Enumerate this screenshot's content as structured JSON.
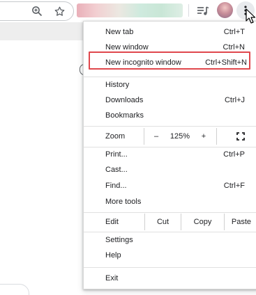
{
  "menu": {
    "items_top": [
      {
        "label": "New tab",
        "accel": "Ctrl+T"
      },
      {
        "label": "New window",
        "accel": "Ctrl+N"
      },
      {
        "label": "New incognito window",
        "accel": "Ctrl+Shift+N"
      }
    ],
    "items_nav": [
      {
        "label": "History",
        "accel": ""
      },
      {
        "label": "Downloads",
        "accel": "Ctrl+J"
      },
      {
        "label": "Bookmarks",
        "accel": ""
      }
    ],
    "zoom": {
      "label": "Zoom",
      "minus": "–",
      "value": "125%",
      "plus": "+"
    },
    "items_tools": [
      {
        "label": "Print...",
        "accel": "Ctrl+P"
      },
      {
        "label": "Cast...",
        "accel": ""
      },
      {
        "label": "Find...",
        "accel": "Ctrl+F"
      },
      {
        "label": "More tools",
        "accel": ""
      }
    ],
    "edit": {
      "label": "Edit",
      "cut": "Cut",
      "copy": "Copy",
      "paste": "Paste"
    },
    "items_settings": [
      {
        "label": "Settings"
      },
      {
        "label": "Help"
      }
    ],
    "exit": {
      "label": "Exit"
    }
  },
  "icons": {
    "zoom": "zoom-in-icon",
    "star": "bookmark-star-icon",
    "media": "media-control-icon",
    "menu": "more-vertical-icon",
    "fullscreen": "fullscreen-icon"
  },
  "colors": {
    "highlight": "#e0474c",
    "menu_bg": "#ffffff",
    "menu_button_bg": "#e8eaed"
  }
}
